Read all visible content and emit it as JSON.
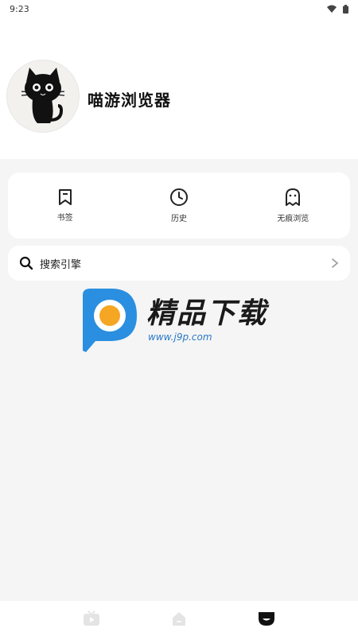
{
  "status_bar": {
    "time": "9:23",
    "icons": [
      "wifi-icon",
      "battery-icon"
    ]
  },
  "profile": {
    "app_name": "喵游浏览器",
    "avatar_icon": "black-cat-icon"
  },
  "quick_actions": [
    {
      "label": "书签",
      "icon": "bookmark-icon"
    },
    {
      "label": "历史",
      "icon": "clock-icon"
    },
    {
      "label": "无痕浏览",
      "icon": "ghost-icon"
    }
  ],
  "search_engine": {
    "label": "搜索引擎",
    "icon": "search-icon",
    "chevron": "chevron-right-icon"
  },
  "watermark": {
    "title": "精品下载",
    "url": "www.j9p.com",
    "brand_color": "#2a8fe0",
    "accent_color": "#f5a623"
  },
  "bottom_nav": [
    {
      "icon": "video-icon",
      "active": false
    },
    {
      "icon": "home-icon",
      "active": false
    },
    {
      "icon": "profile-face-icon",
      "active": true
    }
  ]
}
